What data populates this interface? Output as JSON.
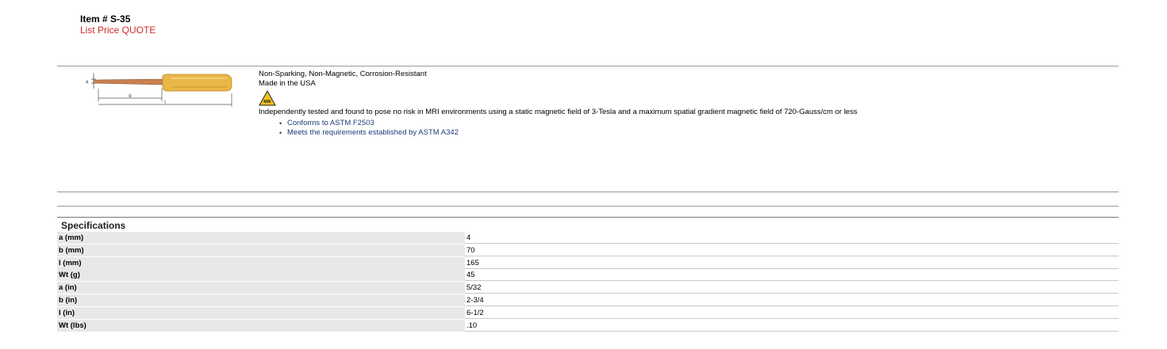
{
  "item": {
    "title": "Item # S-35",
    "price": "List Price QUOTE"
  },
  "diagram": {
    "label_a": "a",
    "label_b": "b",
    "label_l": "l",
    "icon": "screwdriver-dimension-diagram",
    "handle_color": "#e9b648",
    "blade_color": "#c88152"
  },
  "description": {
    "line1": "Non-Sparking, Non-Magnetic, Corrosion-Resistant",
    "line2": "Made in the USA",
    "mri_badge_text": "MRI",
    "statement": "Independently tested and found to pose no risk in MRI environments using a static magnetic field of 3-Tesla and a maximum spatial gradient magnetic field of 720-Gauss/cm or less",
    "bullets": [
      "Conforms to ASTM F2503",
      "Meets the requirements established by ASTM A342"
    ]
  },
  "specifications": {
    "title": "Specifications",
    "rows": [
      {
        "label": "a (mm)",
        "value": "4"
      },
      {
        "label": "b (mm)",
        "value": "70"
      },
      {
        "label": "l (mm)",
        "value": "165"
      },
      {
        "label": "Wt (g)",
        "value": "45"
      },
      {
        "label": "a (in)",
        "value": "5/32"
      },
      {
        "label": "b (in)",
        "value": "2-3/4"
      },
      {
        "label": "l (in)",
        "value": "6-1/2"
      },
      {
        "label": "Wt (lbs)",
        "value": ".10"
      }
    ]
  }
}
